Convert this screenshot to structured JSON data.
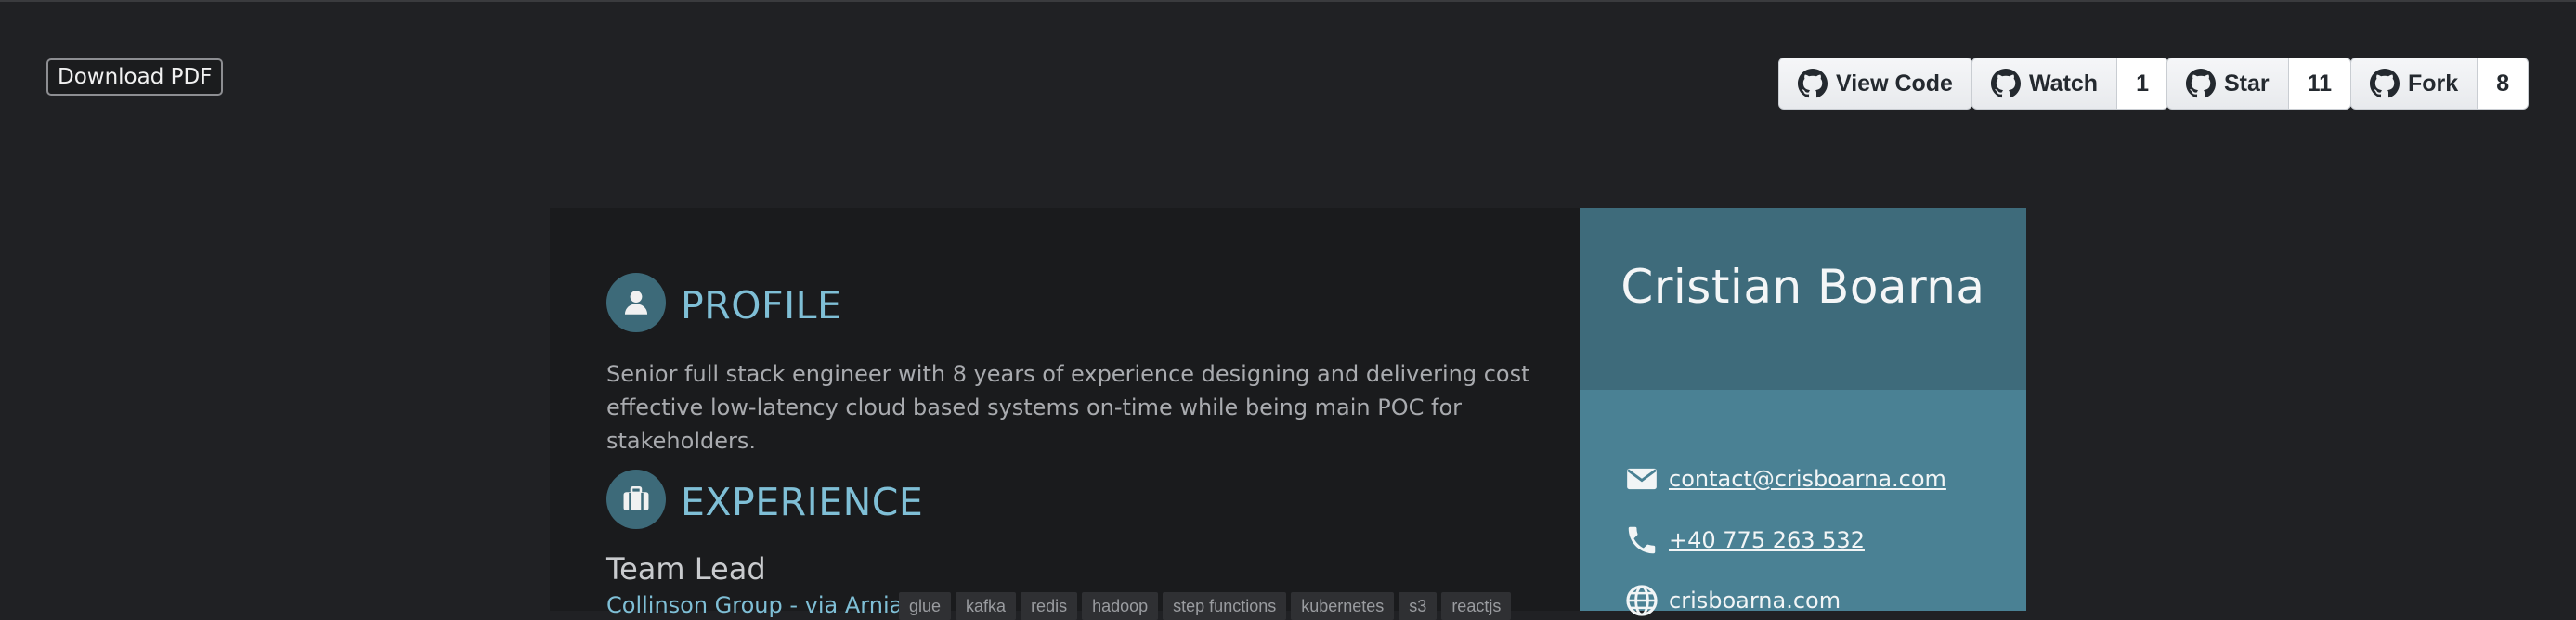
{
  "toolbar": {
    "download_label": "Download PDF"
  },
  "github": {
    "view_code_label": "View Code",
    "watch_label": "Watch",
    "watch_count": "1",
    "star_label": "Star",
    "star_count": "11",
    "fork_label": "Fork",
    "fork_count": "8",
    "icon": "github-icon"
  },
  "sidebar": {
    "name": "Cristian Boarna",
    "contacts": [
      {
        "icon": "envelope-icon",
        "text": "contact@crisboarna.com"
      },
      {
        "icon": "phone-icon",
        "text": "+40 775 263 532"
      },
      {
        "icon": "globe-icon",
        "text": "crisboarna.com"
      }
    ]
  },
  "profile": {
    "title": "PROFILE",
    "icon": "user-icon",
    "text": "Senior full stack engineer with 8 years of experience designing and delivering cost effective low-latency cloud based systems on-time while being main POC for stakeholders."
  },
  "experience": {
    "title": "EXPERIENCE",
    "icon": "briefcase-icon",
    "jobs": [
      {
        "title": "Team Lead",
        "company": "Collinson Group - via Arnia",
        "tags": [
          "glue",
          "kafka",
          "redis",
          "hadoop",
          "step functions",
          "kubernetes",
          "s3",
          "reactjs"
        ]
      }
    ]
  },
  "colors": {
    "background": "#202124",
    "main_panel": "#1a1b1d",
    "sidebar": "#4a8194",
    "sidebar_header": "#3e6b7b",
    "accent": "#7fbfd6"
  }
}
